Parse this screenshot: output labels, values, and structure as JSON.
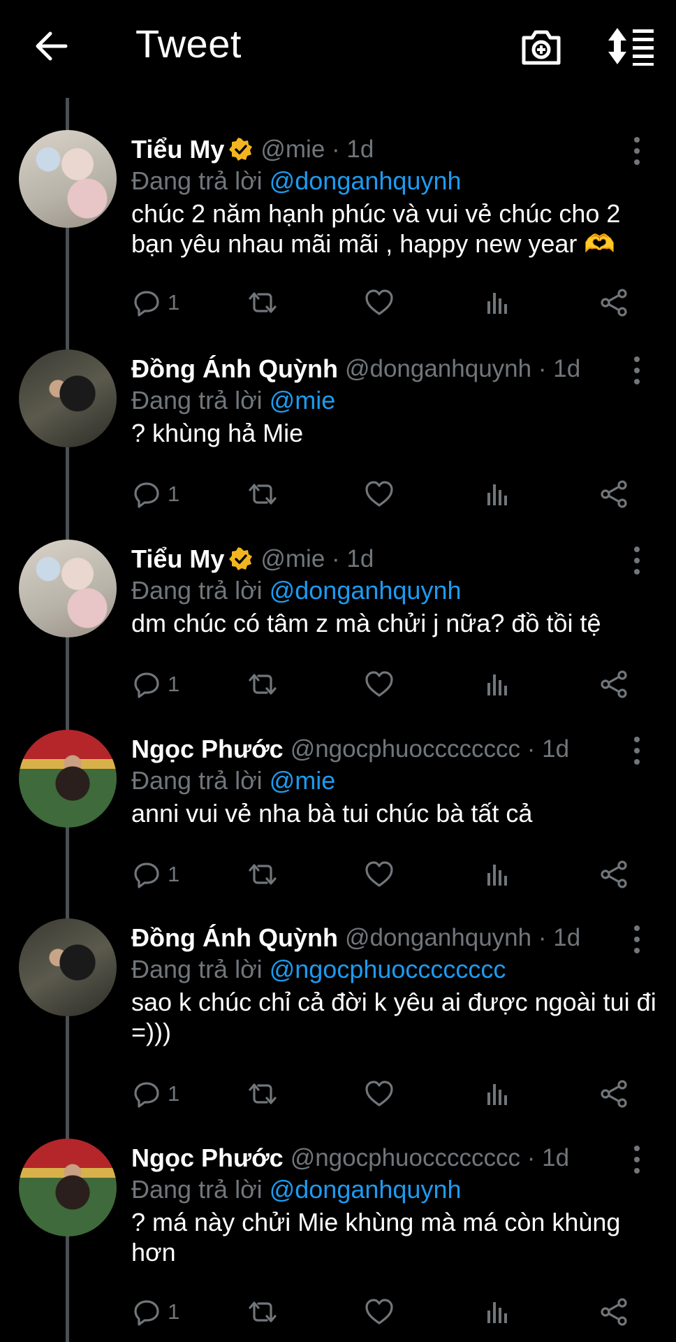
{
  "header": {
    "title": "Tweet",
    "back_icon": "arrow-left-icon",
    "camera_icon": "camera-plus-icon",
    "sort_icon": "sort-icon"
  },
  "colors": {
    "background": "#000000",
    "link": "#1d9bf0",
    "muted": "#71767b",
    "verified": "#f2b51f",
    "text": "#ffffff"
  },
  "tweets": [
    {
      "name": "Tiểu My",
      "verified": true,
      "handle": "@mie",
      "time": "· 1d",
      "reply_prefix": "Đang trả lời",
      "reply_to": "@donganhquynh",
      "text": "chúc 2 năm hạnh phúc và vui vẻ chúc cho 2 bạn yêu nhau mãi mãi , happy new year 🫶",
      "replies": "1"
    },
    {
      "name": "Đồng Ánh Quỳnh",
      "verified": false,
      "handle": "@donganhquynh",
      "time": "· 1d",
      "reply_prefix": "Đang trả lời",
      "reply_to": "@mie",
      "text": "? khùng hả Mie",
      "replies": "1"
    },
    {
      "name": "Tiểu My",
      "verified": true,
      "handle": "@mie",
      "time": "· 1d",
      "reply_prefix": "Đang trả lời",
      "reply_to": "@donganhquynh",
      "text": "dm chúc có tâm z mà chửi j nữa? đồ tồi tệ",
      "replies": "1"
    },
    {
      "name": "Ngọc Phước",
      "verified": false,
      "handle": "@ngocphuocccccccc",
      "time": "· 1d",
      "reply_prefix": "Đang trả lời",
      "reply_to": "@mie",
      "text": "anni vui vẻ nha bà tui chúc bà tất cả",
      "replies": "1"
    },
    {
      "name": "Đồng Ánh Quỳnh",
      "verified": false,
      "handle": "@donganhquynh",
      "time": "· 1d",
      "reply_prefix": "Đang trả lời",
      "reply_to": "@ngocphuocccccccc",
      "text": "sao k chúc chỉ cả đời k yêu ai được ngoài tui đi =)))",
      "replies": "1"
    },
    {
      "name": "Ngọc Phước",
      "verified": false,
      "handle": "@ngocphuocccccccc",
      "time": "· 1d",
      "reply_prefix": "Đang trả lời",
      "reply_to": "@donganhquynh",
      "text": "? má này chửi Mie khùng mà má còn khùng hơn",
      "replies": "1"
    }
  ]
}
